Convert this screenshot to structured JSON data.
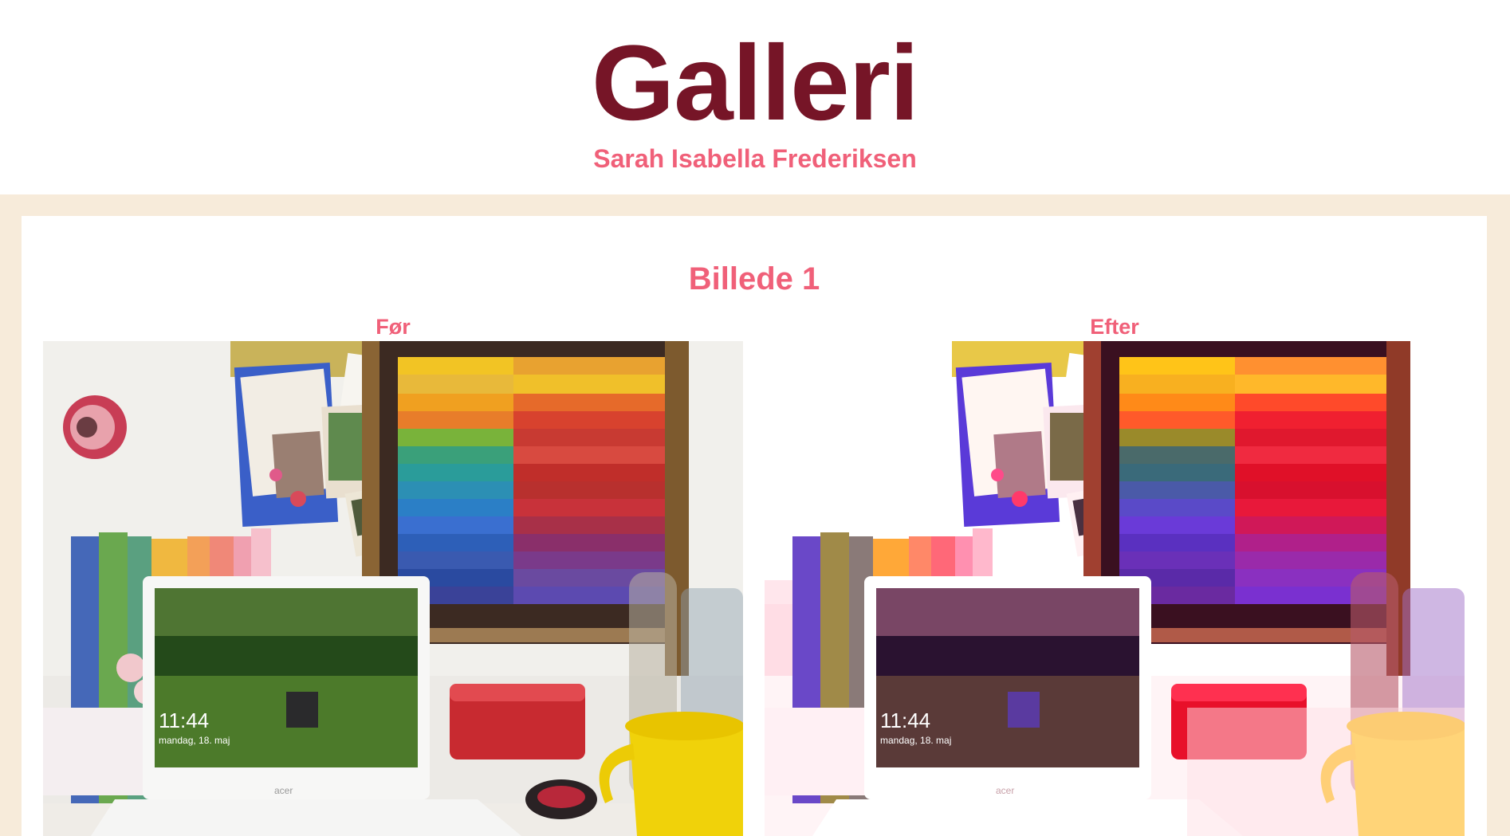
{
  "header": {
    "title": "Galleri",
    "author": "Sarah Isabella Frederiksen"
  },
  "gallery": {
    "section_title": "Billede 1",
    "before_label": "Før",
    "after_label": "Efter",
    "photo_before": {
      "screen_time": "11:44",
      "screen_date": "mandag, 18. maj",
      "laptop_brand": "acer"
    },
    "photo_after": {
      "screen_time": "11:44",
      "screen_date": "mandag, 18. maj",
      "laptop_brand": "acer"
    }
  },
  "colors": {
    "title": "#761527",
    "accent": "#f06079",
    "frame_background": "#f7ebda"
  }
}
